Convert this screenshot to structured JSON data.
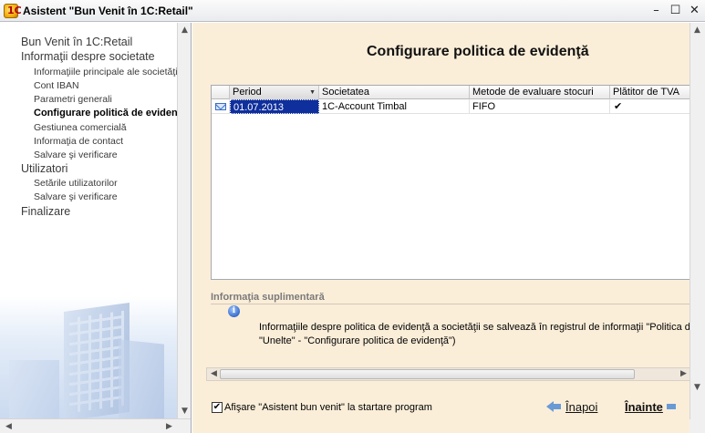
{
  "window": {
    "title": "Asistent \"Bun Venit în 1C:Retail\"",
    "icon": "1c-app-icon",
    "controls": [
      "minimize",
      "maximize",
      "close"
    ]
  },
  "sidebar": {
    "items": [
      {
        "label": "Bun Venit în 1C:Retail",
        "level": 0
      },
      {
        "label": "Informaţii despre societate",
        "level": 0
      },
      {
        "label": "Informaţiile principale ale societăţii",
        "level": 1
      },
      {
        "label": "Cont IBAN",
        "level": 1
      },
      {
        "label": "Parametri generali",
        "level": 1
      },
      {
        "label": "Configurare politică de evidenţă",
        "level": 1,
        "active": true
      },
      {
        "label": "Gestiunea comercială",
        "level": 1
      },
      {
        "label": "Informaţia de contact",
        "level": 1
      },
      {
        "label": "Salvare şi verificare",
        "level": 1
      },
      {
        "label": "Utilizatori",
        "level": 0
      },
      {
        "label": "Setările utilizatorilor",
        "level": 1
      },
      {
        "label": "Salvare şi verificare",
        "level": 1
      },
      {
        "label": "Finalizare",
        "level": 0
      }
    ]
  },
  "main": {
    "title": "Configurare politica de evidenţă",
    "table": {
      "columns": [
        "Period",
        "Societatea",
        "Metode de evaluare stocuri",
        "Plătitor de TVA"
      ],
      "rows": [
        {
          "period": "01.07.2013",
          "company": "1C-Account Timbal",
          "method": "FIFO",
          "vat": "✔"
        }
      ]
    },
    "extra": {
      "header": "Informaţia suplimentară",
      "line1": "Informaţiile despre politica de evidenţă a societăţii se salvează în registrul de informaţii \"Politica de ev",
      "line2": "\"Unelte\" - \"Configurare politica de evidenţă\")"
    }
  },
  "footer": {
    "startup_checkbox_checked": true,
    "startup_checkbox_label": "Afişare \"Asistent bun venit\" la startare program",
    "back_label": "Înapoi",
    "next_label": "Înainte"
  },
  "colors": {
    "main_background": "#fbeed9",
    "selection": "#0f2f9c",
    "accent_arrow": "#6a9ad6"
  }
}
